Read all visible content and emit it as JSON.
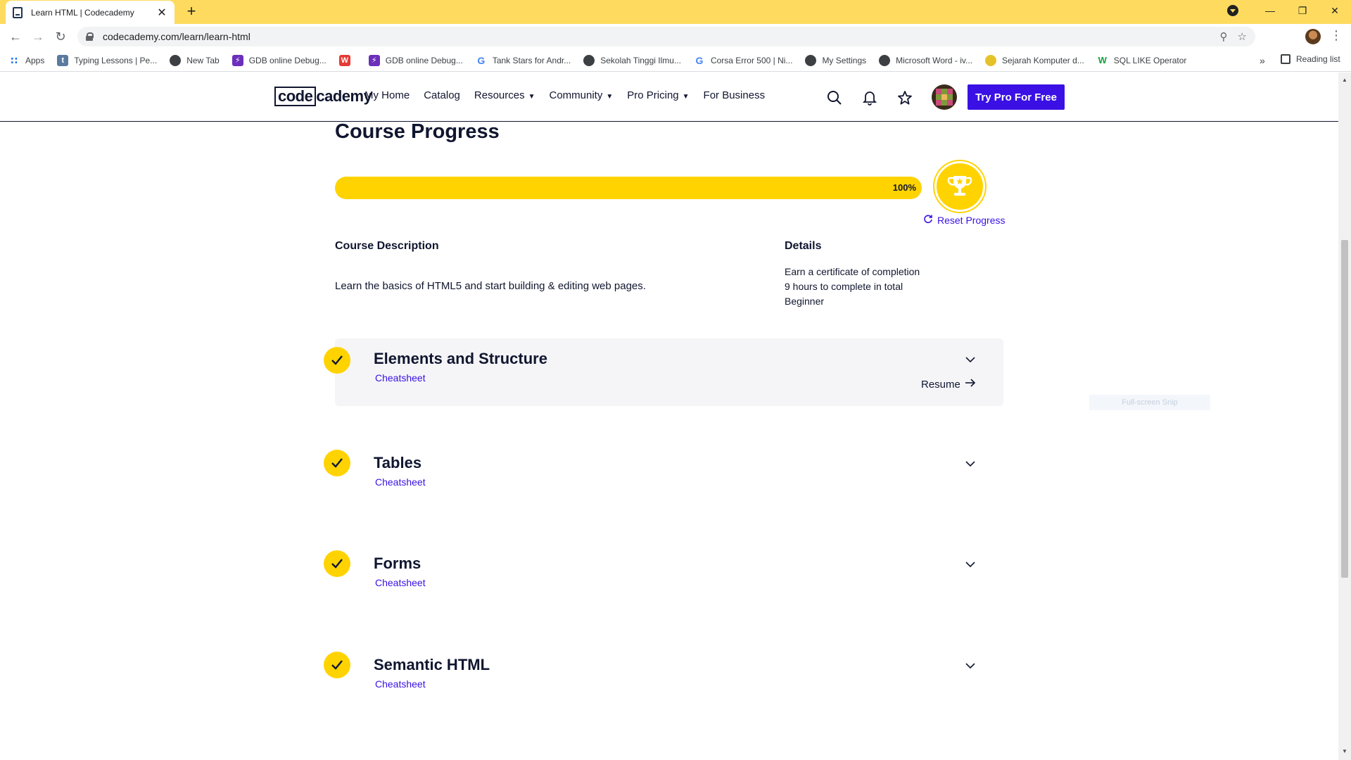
{
  "browser": {
    "tab_title": "Learn HTML | Codecademy",
    "tab_close": "✕",
    "new_tab": "+",
    "window_buttons": [
      "—",
      "❐",
      "✕"
    ],
    "url": "codecademy.com/learn/learn-html",
    "bookmarks": [
      {
        "label": "Apps",
        "icon": "apps-grid-icon"
      },
      {
        "label": "Typing Lessons | Pe...",
        "icon": "typing-icon"
      },
      {
        "label": "New Tab",
        "icon": "globe-icon"
      },
      {
        "label": "GDB online Debug...",
        "icon": "gdb-icon"
      },
      {
        "label": "",
        "icon": "w-icon"
      },
      {
        "label": "GDB online Debug...",
        "icon": "gdb-icon"
      },
      {
        "label": "Tank Stars for Andr...",
        "icon": "google-icon"
      },
      {
        "label": "Sekolah Tinggi Ilmu...",
        "icon": "globe-icon"
      },
      {
        "label": "Corsa Error 500 | Ni...",
        "icon": "google-icon"
      },
      {
        "label": "My Settings",
        "icon": "globe-icon"
      },
      {
        "label": "Microsoft Word - iv...",
        "icon": "globe-icon"
      },
      {
        "label": "Sejarah Komputer d...",
        "icon": "sejarah-icon"
      },
      {
        "label": "SQL LIKE Operator",
        "icon": "w3schools-icon"
      }
    ],
    "bookmarks_more": "»",
    "reading_list": "Reading list"
  },
  "header": {
    "logo_boxed": "code",
    "logo_rest": "cademy",
    "nav": [
      {
        "label": "My Home",
        "dropdown": false
      },
      {
        "label": "Catalog",
        "dropdown": false
      },
      {
        "label": "Resources",
        "dropdown": true
      },
      {
        "label": "Community",
        "dropdown": true
      },
      {
        "label": "Pro Pricing",
        "dropdown": true
      },
      {
        "label": "For Business",
        "dropdown": false
      }
    ],
    "cta": "Try Pro For Free"
  },
  "progress": {
    "title": "Course Progress",
    "percent_label": "100%",
    "percent": 100,
    "reset_label": "Reset Progress"
  },
  "description": {
    "heading": "Course Description",
    "text": "Learn the basics of HTML5 and start building & editing web pages."
  },
  "details": {
    "heading": "Details",
    "items": [
      "Earn a certificate of completion",
      "9 hours to complete in total",
      "Beginner"
    ]
  },
  "modules": [
    {
      "title": "Elements and Structure",
      "link": "Cheatsheet",
      "resume": "Resume",
      "completed": true
    },
    {
      "title": "Tables",
      "link": "Cheatsheet",
      "completed": true
    },
    {
      "title": "Forms",
      "link": "Cheatsheet",
      "completed": true
    },
    {
      "title": "Semantic HTML",
      "link": "Cheatsheet",
      "completed": true
    }
  ],
  "overlay_hint": "Full-screen Snip",
  "colors": {
    "accent_yellow": "#ffd300",
    "accent_purple": "#3a10e5",
    "navy": "#10162f",
    "chrome_yellow": "#fedb5f"
  }
}
